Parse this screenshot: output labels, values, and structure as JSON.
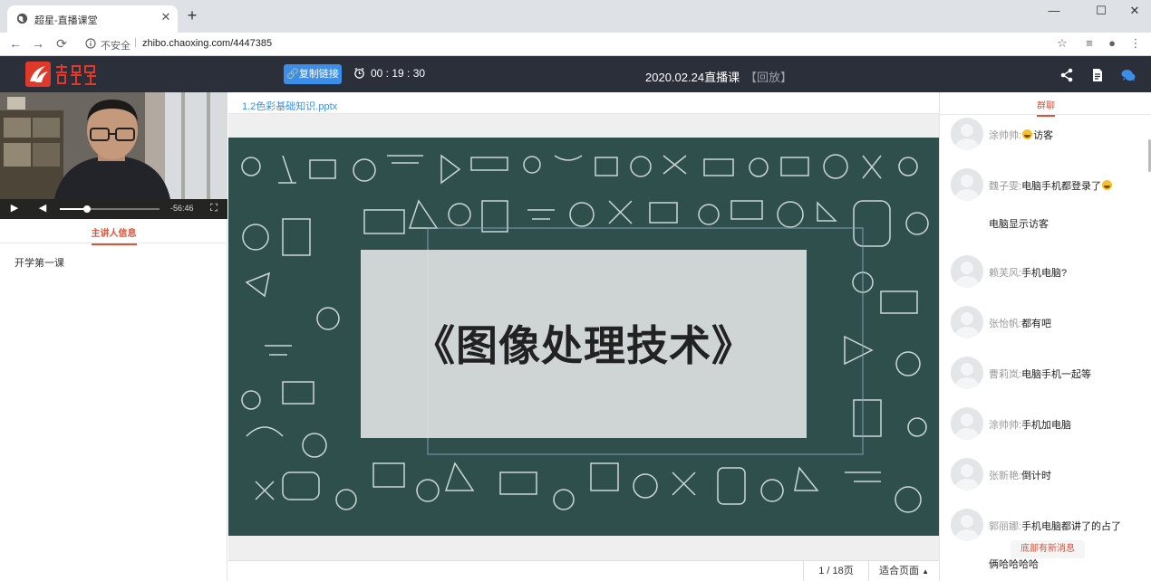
{
  "browser": {
    "tab_title": "超星-直播课堂",
    "insecure_label": "不安全",
    "separator": "|",
    "url": "zhibo.chaoxing.com/4447385"
  },
  "header": {
    "copy_link_label": "复制链接",
    "timer": "00 : 19 : 30",
    "title": "2020.02.24直播课",
    "replay": "【回放】"
  },
  "left": {
    "video_time": "-56:46",
    "video_progress": 0.27,
    "speaker_tab": "主讲人信息",
    "course_title": "开学第一课"
  },
  "center": {
    "file_name": "1.2色彩基础知识.pptx",
    "slide_title": "《图像处理技术》",
    "page_current": "1",
    "page_sep": "/",
    "page_total": "18页",
    "fit_label": "适合页面",
    "fit_arrow": "▲"
  },
  "chat": {
    "tab_label": "群聊",
    "messages": [
      {
        "sender": "涂帅帅",
        "colon": ":",
        "text": "访客"
      },
      {
        "sender": "魏子雯",
        "colon": ":",
        "text": "电脑手机都登录了"
      },
      {
        "line": "电脑显示访客"
      },
      {
        "sender": "赖芙风",
        "colon": ":",
        "text": "手机电脑?"
      },
      {
        "sender": "张怡帆",
        "colon": ":",
        "text": "都有吧"
      },
      {
        "sender": "曹莉岚",
        "colon": ":",
        "text": "电脑手机一起等"
      },
      {
        "sender": "涂帅帅",
        "colon": ":",
        "text": "手机加电脑"
      },
      {
        "sender": "张新艳",
        "colon": ":",
        "text": "倒计时"
      },
      {
        "sender": "郭丽娜",
        "colon": ":",
        "text": "手机电脑都讲了的占了"
      },
      {
        "line": "俩哈哈哈哈"
      }
    ],
    "new_message_tip": "底部有新消息"
  },
  "colors": {
    "accent": "#3d8ee8",
    "header_bg": "#2b2f3a",
    "tab_accent": "#e0533b",
    "slide_bg": "#2e4f4b"
  }
}
